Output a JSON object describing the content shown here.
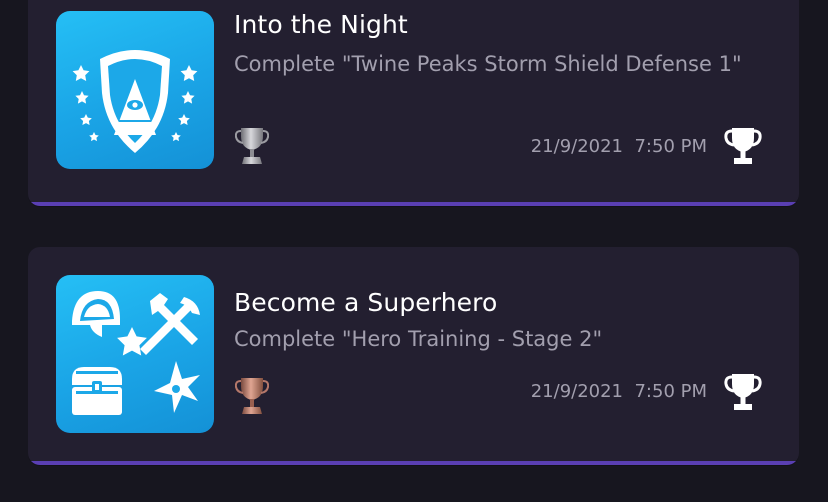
{
  "trophies": [
    {
      "title": "Into the Night",
      "description": "Complete \"Twine Peaks Storm Shield Defense 1\"",
      "date": "21/9/2021",
      "time": "7:50 PM",
      "grade": "silver",
      "art_icon": "shield-pyramid-eye-icon",
      "accent_color": "#5a3fb3"
    },
    {
      "title": "Become a Superhero",
      "description": "Complete \"Hero Training - Stage 2\"",
      "date": "21/9/2021",
      "time": "7:50 PM",
      "grade": "bronze",
      "art_icon": "hero-tools-icon",
      "accent_color": "#5a3fb3"
    }
  ],
  "colors": {
    "background": "#17161f",
    "card": "#231f30",
    "art_blue": "#1aa4e6",
    "silver": "#9c9ca2",
    "bronze": "#b5786a"
  }
}
